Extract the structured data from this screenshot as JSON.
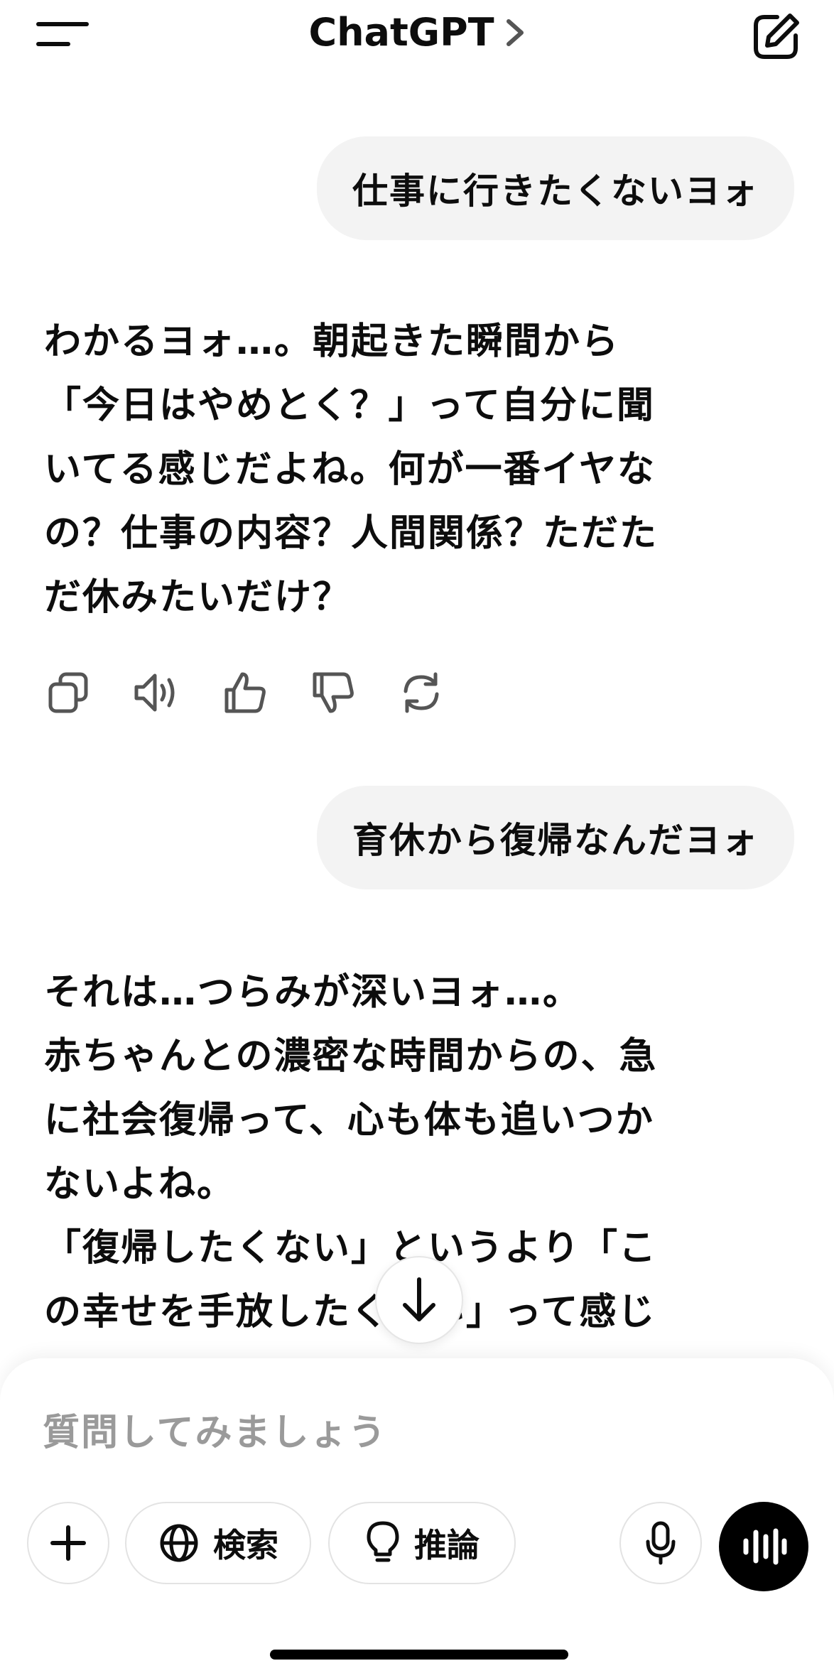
{
  "header": {
    "title": "ChatGPT",
    "menu_icon": "menu-icon",
    "chevron_icon": "chevron-right-icon",
    "new_chat_icon": "edit-icon"
  },
  "messages": {
    "user_1": "仕事に行きたくないヨォ",
    "assistant_1": [
      "わかるヨォ…。朝起きた瞬間から",
      "「今日はやめとく？」って自分に聞",
      "いてる感じだよね。何が一番イヤな",
      "の？仕事の内容？人間関係？ただた",
      "だ休みたいだけ？"
    ],
    "user_2": "育休から復帰なんだヨォ",
    "assistant_2": [
      "それは…つらみが深いヨォ…。",
      "赤ちゃんとの濃密な時間からの、急",
      "に社会復帰って、心も体も追いつか",
      "ないよね。",
      "「復帰したくない」というより「こ",
      "の幸せを手放したくない」って感じ"
    ]
  },
  "actions": [
    "copy-icon",
    "speaker-icon",
    "thumbs-up-icon",
    "thumbs-down-icon",
    "regenerate-icon"
  ],
  "composer": {
    "placeholder": "質問してみましょう",
    "search_label": "検索",
    "reason_label": "推論"
  },
  "colors": {
    "bubble": "#f3f3f3",
    "placeholder": "#9a9a9a",
    "voice_button": "#000000"
  }
}
